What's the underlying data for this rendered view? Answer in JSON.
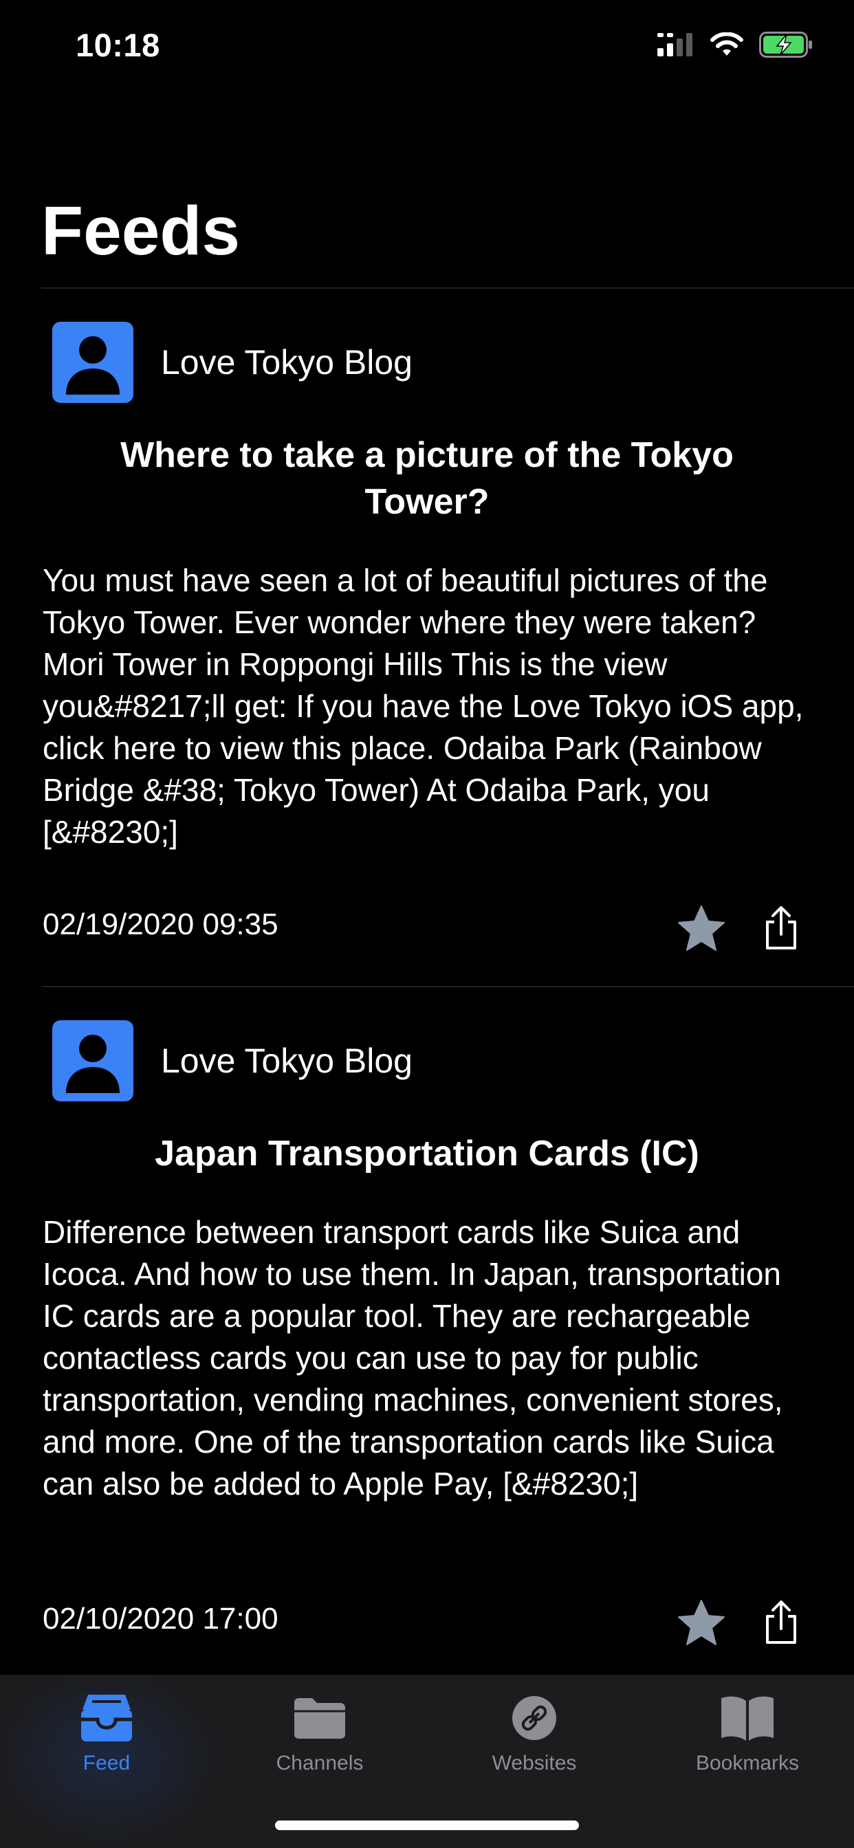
{
  "status_bar": {
    "time": "10:18",
    "icons": [
      "signal-icon",
      "wifi-icon",
      "battery-charging-icon"
    ],
    "battery_color": "#4cd964"
  },
  "header": {
    "title": "Feeds"
  },
  "feed_items": [
    {
      "source": "Love Tokyo Blog",
      "source_icon": "person-avatar-icon",
      "title": "Where to take a picture of the Tokyo Tower?",
      "summary": "You must have seen a lot of beautiful pictures of the Tokyo Tower. Ever wonder where they were taken? Mori Tower in Roppongi Hills This is the view you&#8217;ll get: If you have the Love Tokyo iOS app, click here to view this place. Odaiba Park (Rainbow Bridge &#38; Tokyo Tower) At Odaiba Park, you [&#8230;]",
      "date": "02/19/2020 09:35",
      "bookmark_icon": "star-icon",
      "share_icon": "share-icon"
    },
    {
      "source": "Love Tokyo Blog",
      "source_icon": "person-avatar-icon",
      "title": "Japan Transportation Cards (IC)",
      "summary": "Difference between transport cards like Suica and Icoca. And how to use them. In Japan, transportation IC cards are a popular tool. They are rechargeable contactless cards you can use to pay for public transportation, vending machines, convenient stores, and more. One of the transportation cards like Suica can also be added to Apple Pay, [&#8230;]",
      "date": "02/10/2020 17:00",
      "bookmark_icon": "star-icon",
      "share_icon": "share-icon"
    }
  ],
  "tab_bar": {
    "tabs": [
      {
        "label": "Feed",
        "icon": "inbox-tray-icon",
        "active": true
      },
      {
        "label": "Channels",
        "icon": "folder-icon",
        "active": false
      },
      {
        "label": "Websites",
        "icon": "link-icon",
        "active": false
      },
      {
        "label": "Bookmarks",
        "icon": "book-icon",
        "active": false
      }
    ]
  },
  "colors": {
    "accent": "#3b82f6",
    "inactive_tab": "#8e8e93",
    "star": "#8e9aa8",
    "background": "#000000",
    "tab_bar_background": "#1c1c1e"
  }
}
